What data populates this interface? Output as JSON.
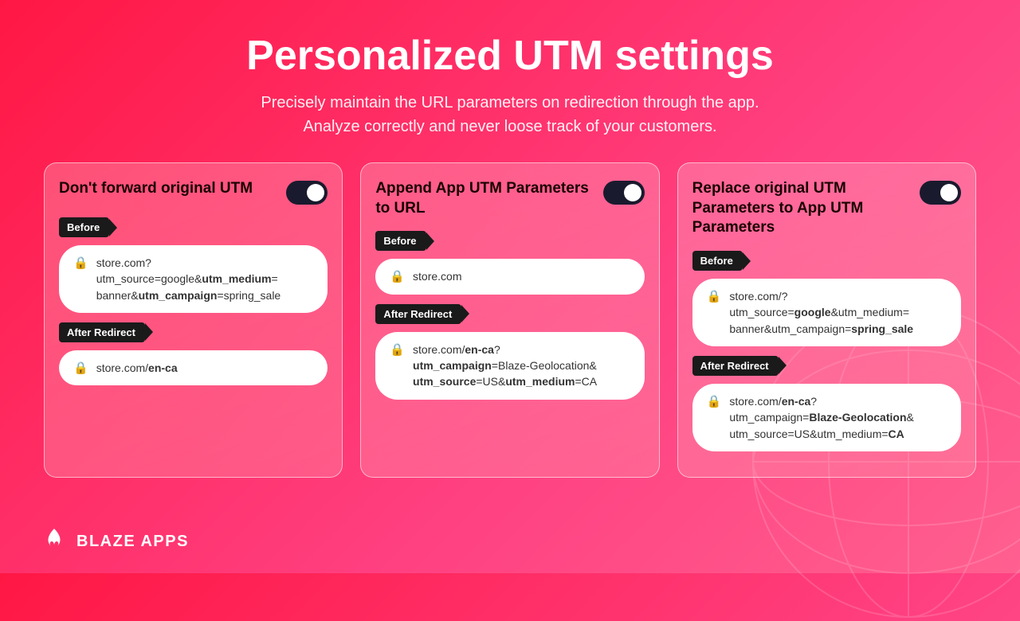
{
  "page": {
    "title": "Personalized UTM settings",
    "subtitle_line1": "Precisely maintain the URL parameters on redirection through the app.",
    "subtitle_line2": "Analyze correctly and never loose track of your customers."
  },
  "brand": {
    "name": "BLAZE APPS"
  },
  "cards": [
    {
      "id": "card-1",
      "title": "Don't forward original UTM",
      "toggle_on": true,
      "before_label": "Before",
      "before_url": "store.com?\nutm_source=google&utm_medium=\nbanner&utm_campaign=spring_sale",
      "before_url_plain": "store.com?",
      "before_url_parts": [
        {
          "text": "store.com?",
          "bold": false
        },
        {
          "text": "\nutm_source=google&",
          "bold": false
        },
        {
          "text": "utm_medium",
          "bold": true
        },
        {
          "text": "=\nbanner&",
          "bold": false
        },
        {
          "text": "utm_campaign",
          "bold": true
        },
        {
          "text": "=spring_sale",
          "bold": false
        }
      ],
      "after_label": "After Redirect",
      "after_url_parts": [
        {
          "text": "store.com/",
          "bold": false
        },
        {
          "text": "en-ca",
          "bold": true
        }
      ]
    },
    {
      "id": "card-2",
      "title": "Append App UTM Parameters to URL",
      "toggle_on": true,
      "before_label": "Before",
      "before_url_parts": [
        {
          "text": "store.com",
          "bold": false
        }
      ],
      "after_label": "After Redirect",
      "after_url_parts": [
        {
          "text": "store.com/",
          "bold": false
        },
        {
          "text": "en-ca",
          "bold": false
        },
        {
          "text": "?\n",
          "bold": false
        },
        {
          "text": "utm_campaign",
          "bold": true
        },
        {
          "text": "=Blaze-Geolocation&\n",
          "bold": false
        },
        {
          "text": "utm_source",
          "bold": true
        },
        {
          "text": "=US&",
          "bold": false
        },
        {
          "text": "utm_medium",
          "bold": true
        },
        {
          "text": "=CA",
          "bold": false
        }
      ]
    },
    {
      "id": "card-3",
      "title": "Replace original UTM Parameters to App UTM Parameters",
      "toggle_on": true,
      "before_label": "Before",
      "before_url_parts": [
        {
          "text": "store.com/?\n",
          "bold": false
        },
        {
          "text": "utm_source=",
          "bold": false
        },
        {
          "text": "google",
          "bold": true
        },
        {
          "text": "&utm_medium=\nbanner&",
          "bold": false
        },
        {
          "text": "utm_campaign=",
          "bold": false
        },
        {
          "text": "spring_sale",
          "bold": true
        }
      ],
      "after_label": "After Redirect",
      "after_url_parts": [
        {
          "text": "store.com/",
          "bold": false
        },
        {
          "text": "en-ca",
          "bold": false
        },
        {
          "text": "?\nutm_campaign=",
          "bold": false
        },
        {
          "text": "Blaze-Geolocation",
          "bold": true
        },
        {
          "text": "&\nutm_source=US&utm_medium=",
          "bold": false
        },
        {
          "text": "CA",
          "bold": true
        }
      ]
    }
  ]
}
